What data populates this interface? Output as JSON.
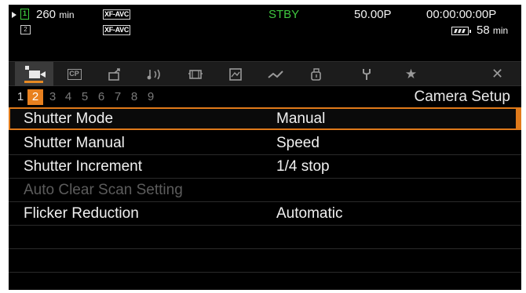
{
  "status": {
    "remaining_time": "260",
    "remaining_unit": "min",
    "codec_a": "XF-AVC",
    "codec_b": "XF-AVC",
    "card_slot": "1",
    "card_slot_2": "2",
    "state": "STBY",
    "frame_rate": "50.00P",
    "timecode": "00:00:00:00",
    "timecode_mode": "P",
    "battery_time": "58",
    "battery_unit": "min",
    "colors": {
      "standby": "#3fc83f",
      "card": "#3fcf3f",
      "accent": "#e8801f"
    }
  },
  "tabs": [
    {
      "icon": "camera-icon",
      "active": true
    },
    {
      "icon": "custom-picture-icon",
      "label": "CP"
    },
    {
      "icon": "recording-setup-icon"
    },
    {
      "icon": "audio-setup-icon"
    },
    {
      "icon": "monitoring-setup-icon"
    },
    {
      "icon": "playback-icon"
    },
    {
      "icon": "system-setup-icon"
    },
    {
      "icon": "network-icon"
    },
    {
      "icon": "assignable-icon"
    },
    {
      "icon": "my-menu-icon"
    },
    {
      "icon": "close-icon"
    }
  ],
  "pages": {
    "numbers": [
      "1",
      "2",
      "3",
      "4",
      "5",
      "6",
      "7",
      "8",
      "9"
    ],
    "current": "2",
    "menu_title": "Camera Setup"
  },
  "menu": {
    "items": [
      {
        "label": "Shutter Mode",
        "value": "Manual",
        "selected": true,
        "enabled": true
      },
      {
        "label": "Shutter Manual",
        "value": "Speed",
        "enabled": true
      },
      {
        "label": "Shutter Increment",
        "value": "1/4 stop",
        "enabled": true
      },
      {
        "label": "Auto Clear Scan Setting",
        "value": "",
        "enabled": false
      },
      {
        "label": "Flicker Reduction",
        "value": "Automatic",
        "enabled": true
      }
    ]
  }
}
